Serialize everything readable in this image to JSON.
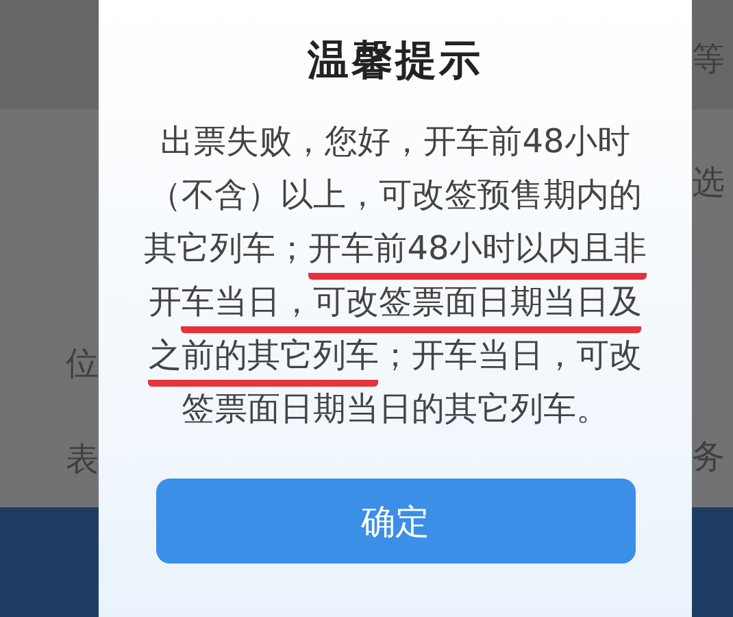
{
  "background": {
    "left_texts": [
      "位",
      "表"
    ],
    "right_texts": [
      "等",
      "选",
      "务"
    ]
  },
  "dialog": {
    "title": "温馨提示",
    "body_lines": [
      [
        {
          "text": "出票失败，您好，开车前48小时",
          "underlined": false
        }
      ],
      [
        {
          "text": "（不含）以上，可改签预售期内的",
          "underlined": false
        }
      ],
      [
        {
          "text": "其它列车；",
          "underlined": false
        },
        {
          "text": "开车前48小时以内且非",
          "underlined": true
        }
      ],
      [
        {
          "text": "开",
          "underlined": false
        },
        {
          "text": "车当日，可改签票面日期当日及",
          "underlined": true
        }
      ],
      [
        {
          "text": "之前的其它列车",
          "underlined": true
        },
        {
          "text": "；开车当日，可改",
          "underlined": false
        }
      ],
      [
        {
          "text": "签票面日期当日的其它列车。",
          "underlined": false
        }
      ]
    ],
    "button": "确定"
  }
}
